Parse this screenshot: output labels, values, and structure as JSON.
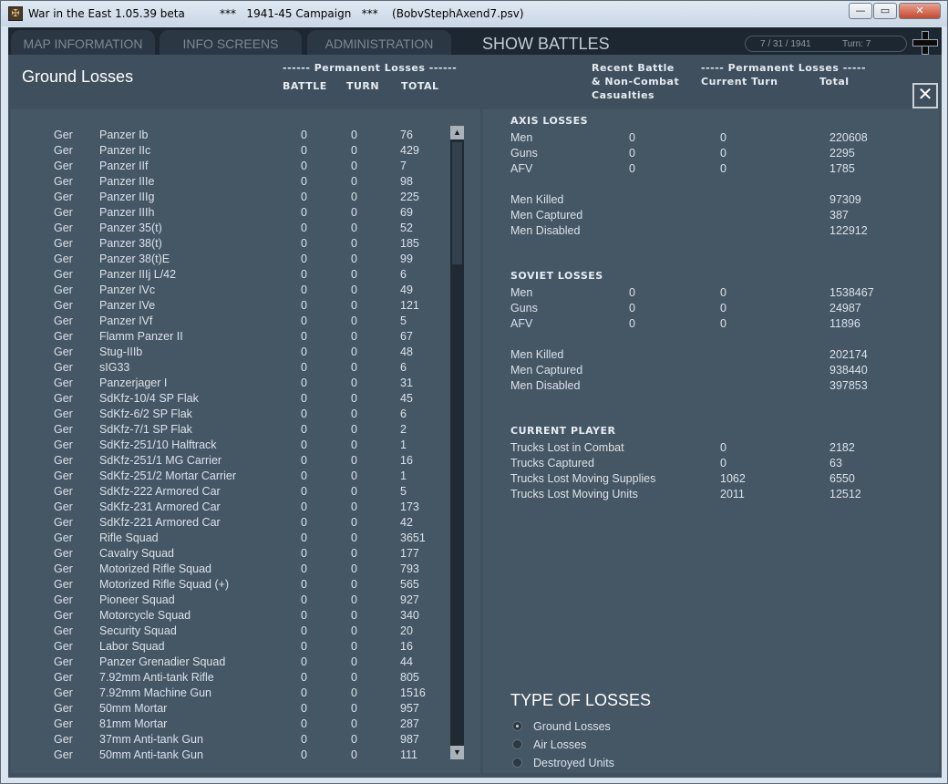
{
  "window": {
    "title": "War in the East 1.05.39 beta          ***   1941-45 Campaign   ***    (BobvStephAxend7.psv)",
    "buttons": {
      "minimize": "—",
      "maximize": "▭",
      "close": "✕"
    }
  },
  "tabs": [
    {
      "label": "MAP INFORMATION"
    },
    {
      "label": "INFO SCREENS"
    },
    {
      "label": "ADMINISTRATION"
    }
  ],
  "active_tab": "SHOW BATTLES",
  "status": {
    "date": "7 / 31 / 1941",
    "turn": "Turn: 7"
  },
  "panel": {
    "title": "Ground Losses",
    "close_glyph": "✕",
    "left_headers": {
      "group": "------ Permanent Losses ------",
      "battle": "BATTLE",
      "turn": "TURN",
      "total": "TOTAL"
    },
    "right_headers": {
      "recent_1": "Recent Battle",
      "recent_2": "& Non-Combat",
      "recent_3": "Casualties",
      "group": "----- Permanent Losses -----",
      "current": "Current Turn",
      "total": "Total"
    }
  },
  "units": [
    {
      "nat": "Ger",
      "name": "Panzer Ib",
      "battle": "0",
      "turn": "0",
      "total": "76"
    },
    {
      "nat": "Ger",
      "name": "Panzer IIc",
      "battle": "0",
      "turn": "0",
      "total": "429"
    },
    {
      "nat": "Ger",
      "name": "Panzer IIf",
      "battle": "0",
      "turn": "0",
      "total": "7"
    },
    {
      "nat": "Ger",
      "name": "Panzer IIIe",
      "battle": "0",
      "turn": "0",
      "total": "98"
    },
    {
      "nat": "Ger",
      "name": "Panzer IIIg",
      "battle": "0",
      "turn": "0",
      "total": "225"
    },
    {
      "nat": "Ger",
      "name": "Panzer IIIh",
      "battle": "0",
      "turn": "0",
      "total": "69"
    },
    {
      "nat": "Ger",
      "name": "Panzer 35(t)",
      "battle": "0",
      "turn": "0",
      "total": "52"
    },
    {
      "nat": "Ger",
      "name": "Panzer 38(t)",
      "battle": "0",
      "turn": "0",
      "total": "185"
    },
    {
      "nat": "Ger",
      "name": "Panzer 38(t)E",
      "battle": "0",
      "turn": "0",
      "total": "99"
    },
    {
      "nat": "Ger",
      "name": "Panzer IIIj L/42",
      "battle": "0",
      "turn": "0",
      "total": "6"
    },
    {
      "nat": "Ger",
      "name": "Panzer IVc",
      "battle": "0",
      "turn": "0",
      "total": "49"
    },
    {
      "nat": "Ger",
      "name": "Panzer IVe",
      "battle": "0",
      "turn": "0",
      "total": "121"
    },
    {
      "nat": "Ger",
      "name": "Panzer IVf",
      "battle": "0",
      "turn": "0",
      "total": "5"
    },
    {
      "nat": "Ger",
      "name": "Flamm Panzer II",
      "battle": "0",
      "turn": "0",
      "total": "67"
    },
    {
      "nat": "Ger",
      "name": "Stug-IIIb",
      "battle": "0",
      "turn": "0",
      "total": "48"
    },
    {
      "nat": "Ger",
      "name": "sIG33",
      "battle": "0",
      "turn": "0",
      "total": "6"
    },
    {
      "nat": "Ger",
      "name": "Panzerjager I",
      "battle": "0",
      "turn": "0",
      "total": "31"
    },
    {
      "nat": "Ger",
      "name": "SdKfz-10/4 SP Flak",
      "battle": "0",
      "turn": "0",
      "total": "45"
    },
    {
      "nat": "Ger",
      "name": "SdKfz-6/2 SP Flak",
      "battle": "0",
      "turn": "0",
      "total": "6"
    },
    {
      "nat": "Ger",
      "name": "SdKfz-7/1 SP Flak",
      "battle": "0",
      "turn": "0",
      "total": "2"
    },
    {
      "nat": "Ger",
      "name": "SdKfz-251/10 Halftrack",
      "battle": "0",
      "turn": "0",
      "total": "1"
    },
    {
      "nat": "Ger",
      "name": "SdKfz-251/1 MG Carrier",
      "battle": "0",
      "turn": "0",
      "total": "16"
    },
    {
      "nat": "Ger",
      "name": "SdKfz-251/2 Mortar Carrier",
      "battle": "0",
      "turn": "0",
      "total": "1"
    },
    {
      "nat": "Ger",
      "name": "SdKfz-222 Armored Car",
      "battle": "0",
      "turn": "0",
      "total": "5"
    },
    {
      "nat": "Ger",
      "name": "SdKfz-231 Armored Car",
      "battle": "0",
      "turn": "0",
      "total": "173"
    },
    {
      "nat": "Ger",
      "name": "SdKfz-221 Armored Car",
      "battle": "0",
      "turn": "0",
      "total": "42"
    },
    {
      "nat": "Ger",
      "name": "Rifle Squad",
      "battle": "0",
      "turn": "0",
      "total": "3651"
    },
    {
      "nat": "Ger",
      "name": "Cavalry Squad",
      "battle": "0",
      "turn": "0",
      "total": "177"
    },
    {
      "nat": "Ger",
      "name": "Motorized Rifle Squad",
      "battle": "0",
      "turn": "0",
      "total": "793"
    },
    {
      "nat": "Ger",
      "name": "Motorized Rifle Squad (+)",
      "battle": "0",
      "turn": "0",
      "total": "565"
    },
    {
      "nat": "Ger",
      "name": "Pioneer Squad",
      "battle": "0",
      "turn": "0",
      "total": "927"
    },
    {
      "nat": "Ger",
      "name": "Motorcycle Squad",
      "battle": "0",
      "turn": "0",
      "total": "340"
    },
    {
      "nat": "Ger",
      "name": "Security Squad",
      "battle": "0",
      "turn": "0",
      "total": "20"
    },
    {
      "nat": "Ger",
      "name": "Labor Squad",
      "battle": "0",
      "turn": "0",
      "total": "16"
    },
    {
      "nat": "Ger",
      "name": "Panzer Grenadier Squad",
      "battle": "0",
      "turn": "0",
      "total": "44"
    },
    {
      "nat": "Ger",
      "name": "7.92mm Anti-tank Rifle",
      "battle": "0",
      "turn": "0",
      "total": "805"
    },
    {
      "nat": "Ger",
      "name": "7.92mm Machine Gun",
      "battle": "0",
      "turn": "0",
      "total": "1516"
    },
    {
      "nat": "Ger",
      "name": "50mm Mortar",
      "battle": "0",
      "turn": "0",
      "total": "957"
    },
    {
      "nat": "Ger",
      "name": "81mm Mortar",
      "battle": "0",
      "turn": "0",
      "total": "287"
    },
    {
      "nat": "Ger",
      "name": "37mm Anti-tank Gun",
      "battle": "0",
      "turn": "0",
      "total": "987"
    },
    {
      "nat": "Ger",
      "name": "50mm Anti-tank Gun",
      "battle": "0",
      "turn": "0",
      "total": "111"
    }
  ],
  "scrollbar": {
    "up": "▲",
    "down": "▼"
  },
  "axis": {
    "title": "AXIS LOSSES",
    "rows": [
      {
        "label": "Men",
        "recent": "0",
        "current": "0",
        "total": "220608"
      },
      {
        "label": "Guns",
        "recent": "0",
        "current": "0",
        "total": "2295"
      },
      {
        "label": "AFV",
        "recent": "0",
        "current": "0",
        "total": "1785"
      }
    ],
    "casualties": [
      {
        "label": "Men Killed",
        "total": "97309"
      },
      {
        "label": "Men Captured",
        "total": "387"
      },
      {
        "label": "Men Disabled",
        "total": "122912"
      }
    ]
  },
  "soviet": {
    "title": "SOVIET LOSSES",
    "rows": [
      {
        "label": "Men",
        "recent": "0",
        "current": "0",
        "total": "1538467"
      },
      {
        "label": "Guns",
        "recent": "0",
        "current": "0",
        "total": "24987"
      },
      {
        "label": "AFV",
        "recent": "0",
        "current": "0",
        "total": "11896"
      }
    ],
    "casualties": [
      {
        "label": "Men Killed",
        "total": "202174"
      },
      {
        "label": "Men Captured",
        "total": "938440"
      },
      {
        "label": "Men Disabled",
        "total": "397853"
      }
    ]
  },
  "player": {
    "title": "CURRENT PLAYER",
    "rows": [
      {
        "label": "Trucks Lost in Combat",
        "current": "0",
        "total": "2182"
      },
      {
        "label": "Trucks Captured",
        "current": "0",
        "total": "63"
      },
      {
        "label": "Trucks Lost Moving Supplies",
        "current": "1062",
        "total": "6550"
      },
      {
        "label": "Trucks Lost Moving Units",
        "current": "2011",
        "total": "12512"
      }
    ]
  },
  "loss_types": {
    "title": "TYPE OF LOSSES",
    "options": [
      {
        "label": "Ground Losses",
        "selected": true
      },
      {
        "label": "Air Losses",
        "selected": false
      },
      {
        "label": "Destroyed Units",
        "selected": false
      }
    ]
  }
}
